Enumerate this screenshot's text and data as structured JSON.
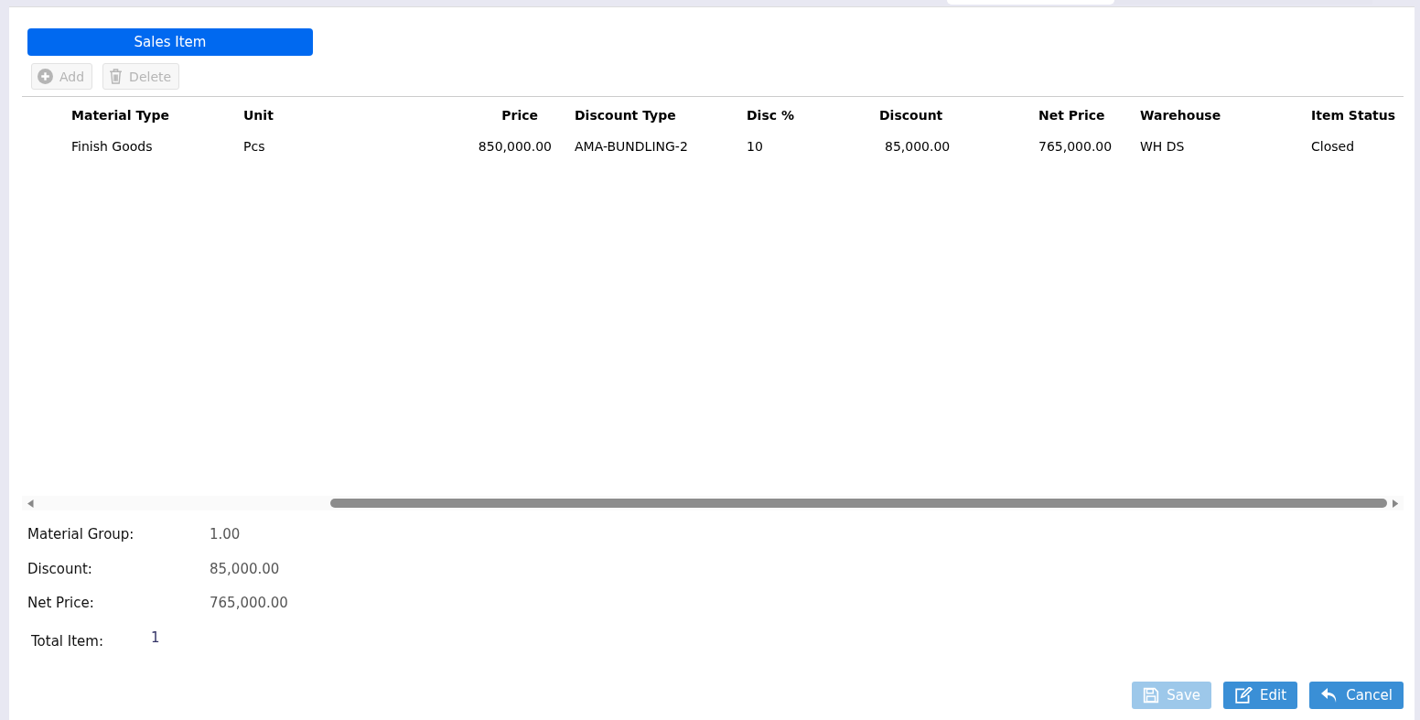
{
  "section_button": {
    "label": "Sales Item",
    "selected": true
  },
  "toolbar": [
    {
      "kind": "add",
      "label": "Add",
      "disabled": true
    },
    {
      "kind": "delete",
      "label": "Delete",
      "disabled": true
    }
  ],
  "table": {
    "columns": [
      "Material Type",
      "Unit",
      "Price",
      "Discount Type",
      "Disc %",
      "Discount",
      "Net Price",
      "Warehouse",
      "Item Status"
    ],
    "rows": [
      [
        "Finish Goods",
        "Pcs",
        "850,000.00",
        "AMA-BUNDLING-2",
        "10",
        "85,000.00",
        "765,000.00",
        "WH DS",
        "Closed"
      ]
    ]
  },
  "summary": [
    {
      "label": "Material Group:",
      "value": "1.00"
    },
    {
      "label": "Discount:",
      "value": "85,000.00"
    },
    {
      "label": "Net Price:",
      "value": "765,000.00"
    }
  ],
  "total_item": {
    "label": "Total Item:",
    "value": "1"
  },
  "actions": [
    {
      "kind": "save",
      "label": "Save",
      "disabled": true
    },
    {
      "kind": "edit",
      "label": "Edit",
      "disabled": false
    },
    {
      "kind": "cancel",
      "label": "Cancel",
      "disabled": false
    }
  ]
}
